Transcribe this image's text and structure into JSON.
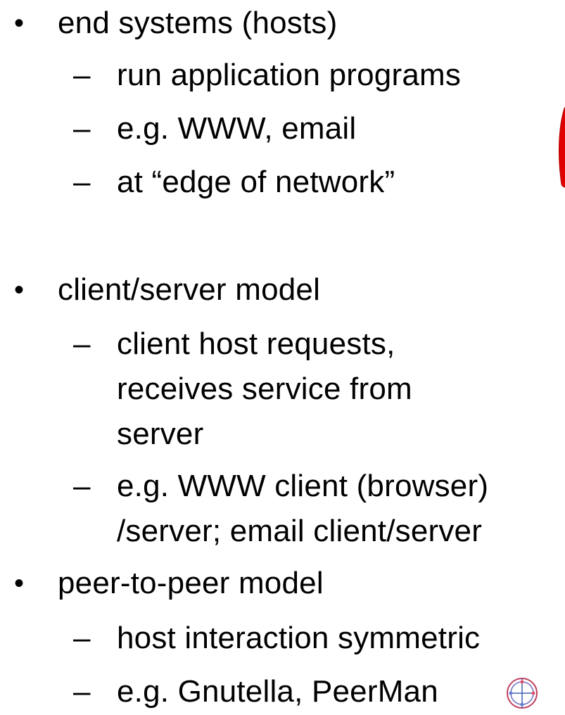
{
  "slide": {
    "sections": [
      {
        "bullet": "•",
        "heading": "end systems (hosts)",
        "items": [
          {
            "dash": "–",
            "lines": [
              "run application programs"
            ]
          },
          {
            "dash": "–",
            "lines": [
              "e.g. WWW, email"
            ]
          },
          {
            "dash": "–",
            "lines": [
              "at “edge of network”"
            ]
          }
        ]
      },
      {
        "bullet": "•",
        "heading": "client/server model",
        "items": [
          {
            "dash": "–",
            "lines": [
              "client host requests,",
              "receives service from",
              "server"
            ]
          },
          {
            "dash": "–",
            "lines": [
              "e.g. WWW client (browser)",
              "/server; email client/server"
            ]
          }
        ]
      },
      {
        "bullet": "•",
        "heading": "peer-to-peer model",
        "items": [
          {
            "dash": "–",
            "lines": [
              "host interaction symmetric"
            ]
          },
          {
            "dash": "–",
            "lines": [
              "e.g. Gnutella, PeerMan"
            ]
          }
        ]
      }
    ],
    "decor": {
      "red_shape_color": "#e00000",
      "peerman_icon": "peerman-globe-icon"
    }
  }
}
